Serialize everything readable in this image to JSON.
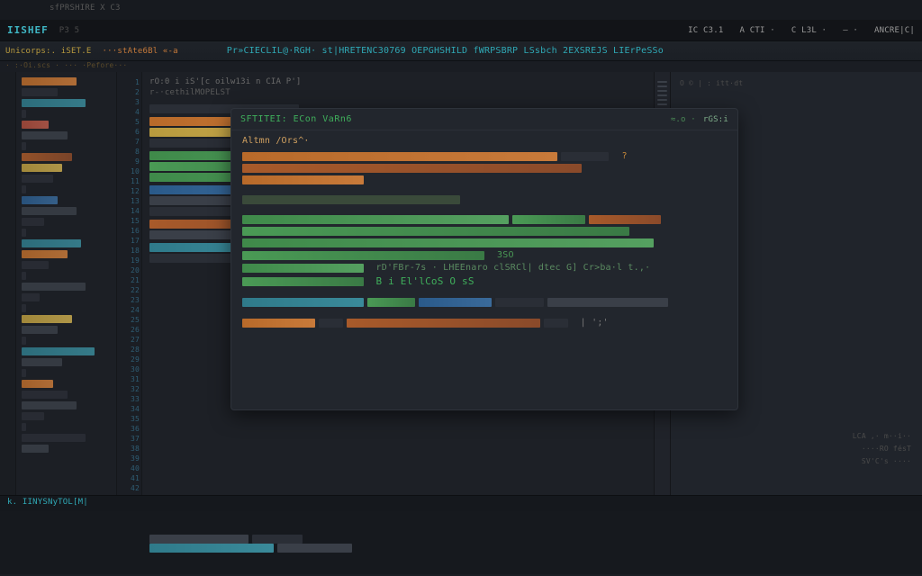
{
  "chrome": {
    "top_hint": "sfPRSHIRE X C3",
    "brand": "IISHEF",
    "brand_sub": "P3 5",
    "status_items": [
      "IC C3.1",
      "A CTI ·",
      "C L3L ·",
      "— ·",
      "ANCRE|C|"
    ]
  },
  "pathbar": {
    "crumb1": "Unicorps:. iSET.E",
    "crumb2": "···stAte6Bl «-a",
    "tabs": "Pr»CIECLIL@·RGH· st|HRETENC30769 OEPGHSHILD fWRPSBRP LSsbch  2EXSREJS LIErPeSSo",
    "ghost": "· :·Oi.scs · ··· ·Pefore···"
  },
  "sidebar_rows": [
    {
      "cls": "c-orange",
      "w": "w60"
    },
    {
      "cls": "c-dim",
      "w": "w40"
    },
    {
      "cls": "c-teal",
      "w": "w70"
    },
    {
      "cls": "c-dim",
      "w": "w5"
    },
    {
      "cls": "c-red",
      "w": "w30"
    },
    {
      "cls": "c-gray",
      "w": "w50"
    },
    {
      "cls": "c-dim",
      "w": "w5"
    },
    {
      "cls": "c-orange2",
      "w": "w55"
    },
    {
      "cls": "c-yellow",
      "w": "w45"
    },
    {
      "cls": "c-dim",
      "w": "w35"
    },
    {
      "cls": "c-dim",
      "w": "w5"
    },
    {
      "cls": "c-blue",
      "w": "w40"
    },
    {
      "cls": "c-gray",
      "w": "w60"
    },
    {
      "cls": "c-dim",
      "w": "w25"
    },
    {
      "cls": "c-dim",
      "w": "w5"
    },
    {
      "cls": "c-teal",
      "w": "w65"
    },
    {
      "cls": "c-orange",
      "w": "w50"
    },
    {
      "cls": "c-dim",
      "w": "w30"
    },
    {
      "cls": "c-dim",
      "w": "w5"
    },
    {
      "cls": "c-gray",
      "w": "w70"
    },
    {
      "cls": "c-dim",
      "w": "w20"
    },
    {
      "cls": "c-dim",
      "w": "w5"
    },
    {
      "cls": "c-yellow",
      "w": "w55"
    },
    {
      "cls": "c-gray",
      "w": "w40"
    },
    {
      "cls": "c-dim",
      "w": "w5"
    },
    {
      "cls": "c-teal",
      "w": "w80"
    },
    {
      "cls": "c-gray",
      "w": "w45"
    },
    {
      "cls": "c-dim",
      "w": "w5"
    },
    {
      "cls": "c-orange",
      "w": "w35"
    },
    {
      "cls": "c-dim",
      "w": "w50"
    },
    {
      "cls": "c-gray",
      "w": "w60"
    },
    {
      "cls": "c-dim",
      "w": "w25"
    },
    {
      "cls": "c-dim",
      "w": "w5"
    },
    {
      "cls": "c-dim",
      "w": "w70"
    },
    {
      "cls": "c-gray",
      "w": "w30"
    }
  ],
  "linenumbers_count": 42,
  "code_header": [
    "rO:0 i iS'[c oilw13i n CIA P']",
    "r-·cethilMOPELST"
  ],
  "code_rows": [
    {
      "parts": [
        {
          "cls": "c-dim",
          "w": "w30"
        }
      ]
    },
    {
      "gap": true
    },
    {
      "parts": [
        {
          "cls": "c-orange",
          "w": "w45"
        },
        {
          "cls": "c-gray",
          "w": "w10"
        }
      ]
    },
    {
      "parts": [
        {
          "cls": "c-yellow",
          "w": "w35"
        },
        {
          "cls": "c-orange2",
          "w": "w20"
        }
      ]
    },
    {
      "parts": [
        {
          "cls": "c-dim",
          "w": "w25"
        }
      ]
    },
    {
      "gap": true
    },
    {
      "parts": [
        {
          "cls": "c-green",
          "w": "w55"
        },
        {
          "cls": "c-teal",
          "w": "w20"
        }
      ]
    },
    {
      "parts": [
        {
          "cls": "c-green2",
          "w": "w40"
        }
      ]
    },
    {
      "parts": [
        {
          "cls": "c-green",
          "w": "w65"
        }
      ]
    },
    {
      "gap": true
    },
    {
      "parts": [
        {
          "cls": "c-blue",
          "w": "w30"
        },
        {
          "cls": "c-orange",
          "w": "w25"
        }
      ]
    },
    {
      "parts": [
        {
          "cls": "c-gray",
          "w": "w50"
        }
      ]
    },
    {
      "parts": [
        {
          "cls": "c-dim",
          "w": "w20"
        }
      ]
    },
    {
      "gap": true
    },
    {
      "parts": [
        {
          "cls": "c-orange2",
          "w": "w40"
        },
        {
          "cls": "c-dim",
          "w": "w15"
        }
      ]
    },
    {
      "parts": [
        {
          "cls": "c-gray",
          "w": "w55"
        }
      ]
    },
    {
      "gap": true
    },
    {
      "parts": [
        {
          "cls": "c-teal",
          "w": "w25"
        },
        {
          "cls": "c-yellow",
          "w": "w30"
        }
      ]
    },
    {
      "parts": [
        {
          "cls": "c-dim",
          "w": "w45"
        }
      ]
    }
  ],
  "popup": {
    "title": "SFTITEI: ECon VaRn6",
    "meta": "≈.o ·",
    "close": "rGS:i",
    "subtitle": "Altmn /Ors^·",
    "blocks": [
      {
        "type": "lines",
        "lines": [
          {
            "parts": [
              {
                "cls": "c-orange",
                "w": "w65"
              },
              {
                "cls": "c-dim",
                "w": "w10"
              },
              {
                "text": "?",
                "color": "#c88a3a"
              }
            ]
          },
          {
            "parts": [
              {
                "cls": "c-orange2",
                "w": "w70"
              }
            ]
          },
          {
            "parts": [
              {
                "cls": "c-orange",
                "w": "w25"
              }
            ]
          }
        ]
      },
      {
        "type": "gap"
      },
      {
        "type": "lines",
        "lines": [
          {
            "parts": [
              {
                "cls": "c-comment",
                "w": "w45"
              }
            ]
          }
        ]
      },
      {
        "type": "gap"
      },
      {
        "type": "lines",
        "lines": [
          {
            "parts": [
              {
                "cls": "c-green",
                "w": "w55"
              },
              {
                "cls": "c-green2",
                "w": "w15"
              },
              {
                "cls": "c-orange2",
                "w": "w15"
              }
            ]
          },
          {
            "parts": [
              {
                "cls": "c-green2",
                "w": "w80"
              }
            ]
          },
          {
            "parts": [
              {
                "cls": "c-green",
                "w": "w85"
              }
            ]
          },
          {
            "parts": [
              {
                "cls": "c-green2",
                "w": "w50"
              },
              {
                "text": "3SO",
                "color": "#4a9a55"
              }
            ]
          },
          {
            "parts": [
              {
                "cls": "c-green",
                "w": "w25"
              },
              {
                "text": "rD'FBr-7s · LHEEnaro clSRCl| dtec G] Cr>ba·l t.,·",
                "color": "#5a8a60"
              }
            ]
          },
          {
            "parts": [
              {
                "cls": "c-green2",
                "w": "w25"
              },
              {
                "text": "B i  El'lCoS O sS",
                "color": "#3fae5b",
                "big": true
              }
            ]
          }
        ]
      },
      {
        "type": "gap"
      },
      {
        "type": "lines",
        "lines": [
          {
            "parts": [
              {
                "cls": "c-teal",
                "w": "w25"
              },
              {
                "cls": "c-green2",
                "w": "w10"
              },
              {
                "cls": "c-blue",
                "w": "w15"
              },
              {
                "cls": "c-dim",
                "w": "w10"
              },
              {
                "cls": "c-gray",
                "w": "w25"
              }
            ]
          }
        ]
      },
      {
        "type": "gap"
      },
      {
        "type": "lines",
        "lines": [
          {
            "parts": [
              {
                "cls": "c-orange",
                "w": "w15"
              },
              {
                "cls": "c-dim",
                "w": "w5"
              },
              {
                "cls": "c-orange2",
                "w": "w40"
              },
              {
                "cls": "c-dim",
                "w": "w5"
              },
              {
                "text": "| ';'",
                "color": "#7a7a7a"
              }
            ]
          }
        ]
      }
    ]
  },
  "below_popup_rows": [
    {
      "parts": [
        {
          "cls": "c-gray",
          "w": "w20"
        },
        {
          "cls": "c-dim",
          "w": "w10"
        }
      ]
    },
    {
      "parts": [
        {
          "cls": "c-teal",
          "w": "w25"
        },
        {
          "cls": "c-gray",
          "w": "w15"
        }
      ]
    }
  ],
  "right_rail_hint": "O © | : itt·dt",
  "term_tab": "k. IINYSNyTOL[M|",
  "terminal_rows": [
    {
      "parts": [
        {
          "cls": "c-gray",
          "w": "w10"
        },
        {
          "cls": "c-dim",
          "w": "w15"
        },
        {
          "cls": "c-gray",
          "w": "w10"
        }
      ]
    },
    {
      "parts": [
        {
          "cls": "c-blue",
          "w": "w20"
        },
        {
          "cls": "c-gray",
          "w": "w10"
        },
        {
          "cls": "c-yellow",
          "w": "w35"
        },
        {
          "cls": "c-dim",
          "w": "w5"
        },
        {
          "cls": "c-gray",
          "w": "w5"
        }
      ]
    },
    {
      "parts": [
        {
          "cls": "c-orange2",
          "w": "w25"
        },
        {
          "cls": "c-gray",
          "w": "w10"
        },
        {
          "cls": "c-dim",
          "w": "w20"
        },
        {
          "cls": "c-yellow",
          "w": "w15"
        }
      ]
    },
    {
      "parts": [
        {
          "cls": "c-dim",
          "w": "w5"
        },
        {
          "cls": "c-gray",
          "w": "w30"
        },
        {
          "cls": "c-yellow",
          "w": "w10"
        },
        {
          "cls": "c-green2",
          "w": "w15"
        },
        {
          "cls": "c-orange",
          "w": "w20"
        }
      ]
    }
  ],
  "right_bottom_hints": [
    "LCA ,· m··i··",
    "····RO fésT",
    "SV'C's  ····"
  ]
}
